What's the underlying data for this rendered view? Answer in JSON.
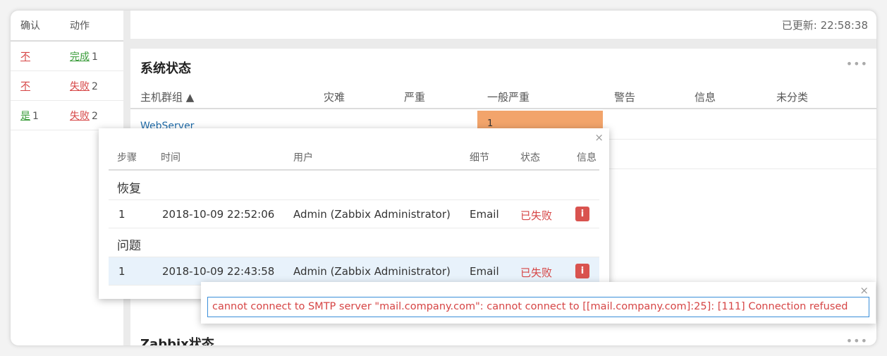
{
  "left_table": {
    "headers": [
      "确认",
      "动作"
    ],
    "rows": [
      {
        "ack": "不",
        "ack_count": "",
        "action": "完成",
        "action_count": "1"
      },
      {
        "ack": "不",
        "ack_count": "",
        "action": "失败",
        "action_count": "2"
      },
      {
        "ack": "是",
        "ack_count": "1",
        "action": "失败",
        "action_count": "2"
      }
    ]
  },
  "topbar": {
    "updated": "已更新: 22:58:38"
  },
  "system_status": {
    "title": "系统状态",
    "menu": "•••",
    "headers": [
      "主机群组 ▲",
      "灾难",
      "严重",
      "一般严重",
      "警告",
      "信息",
      "未分类"
    ],
    "rows": [
      {
        "host": "WebServer",
        "average": "1"
      }
    ]
  },
  "zabbix_status": {
    "title": "Zabbix状态",
    "menu": "•••"
  },
  "actions_popup": {
    "close": "×",
    "headers": [
      "步骤",
      "时间",
      "用户",
      "细节",
      "状态",
      "信息"
    ],
    "sections": [
      {
        "title": "恢复",
        "rows": [
          {
            "step": "1",
            "time": "2018-10-09 22:52:06",
            "user": "Admin (Zabbix Administrator)",
            "detail": "Email",
            "status": "已失败",
            "info": "i"
          }
        ]
      },
      {
        "title": "问题",
        "rows": [
          {
            "step": "1",
            "time": "2018-10-09 22:43:58",
            "user": "Admin (Zabbix Administrator)",
            "detail": "Email",
            "status": "已失败",
            "info": "i"
          }
        ]
      }
    ]
  },
  "error_hint": {
    "close": "×",
    "message": "cannot connect to SMTP server \"mail.company.com\": cannot connect to [[mail.company.com]:25]: [111] Connection refused"
  }
}
